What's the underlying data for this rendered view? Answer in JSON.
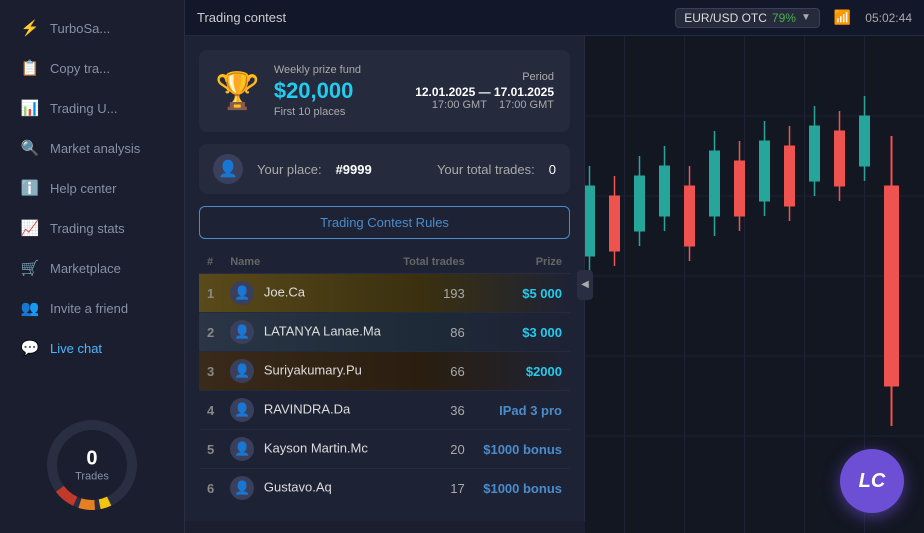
{
  "sidebar": {
    "items": [
      {
        "id": "turbosave",
        "label": "TurboSa...",
        "icon": "⚡",
        "active": false
      },
      {
        "id": "copy-trading",
        "label": "Copy tra...",
        "icon": "📋",
        "active": false
      },
      {
        "id": "trading-ui",
        "label": "Trading U...",
        "icon": "📊",
        "active": false
      },
      {
        "id": "market-analysis",
        "label": "Market analysis",
        "icon": "🔍",
        "active": false
      },
      {
        "id": "help-center",
        "label": "Help center",
        "icon": "ℹ️",
        "active": false
      },
      {
        "id": "trading-stats",
        "label": "Trading stats",
        "icon": "📈",
        "active": false
      },
      {
        "id": "marketplace",
        "label": "Marketplace",
        "icon": "🛒",
        "active": false
      },
      {
        "id": "invite-friend",
        "label": "Invite a friend",
        "icon": "👥",
        "active": false
      },
      {
        "id": "live-chat",
        "label": "Live chat",
        "icon": "💬",
        "active": true
      }
    ],
    "trades_count": "0",
    "trades_label": "Trades"
  },
  "topbar": {
    "title": "Trading contest",
    "currency": "EUR/USD OTC",
    "percentage": "79%",
    "time": "05:02:44"
  },
  "contest": {
    "prize_label": "Weekly prize fund",
    "prize_amount": "$20,000",
    "first_places": "First 10 places",
    "period_label": "Period",
    "period_dates": "12.01.2025 — 17.01.2025",
    "period_time_start": "17:00 GMT",
    "period_time_end": "17:00 GMT",
    "your_place_label": "Your place:",
    "your_place_value": "#9999",
    "your_trades_label": "Your total trades:",
    "your_trades_value": "0",
    "rules_button": "Trading Contest Rules"
  },
  "leaderboard": {
    "headers": {
      "num": "#",
      "name": "Name",
      "total_trades": "Total trades",
      "prize": "Prize"
    },
    "rows": [
      {
        "rank": 1,
        "name": "Joe.Ca",
        "trades": 193,
        "prize": "$5 000",
        "prize_type": "money"
      },
      {
        "rank": 2,
        "name": "LATANYA Lanae.Ma",
        "trades": 86,
        "prize": "$3 000",
        "prize_type": "money"
      },
      {
        "rank": 3,
        "name": "Suriyakumary.Pu",
        "trades": 66,
        "prize": "$2000",
        "prize_type": "money"
      },
      {
        "rank": 4,
        "name": "RAVINDRA.Da",
        "trades": 36,
        "prize": "IPad 3 pro",
        "prize_type": "ipad"
      },
      {
        "rank": 5,
        "name": "Kayson Martin.Mc",
        "trades": 20,
        "prize": "$1000 bonus",
        "prize_type": "bonus"
      },
      {
        "rank": 6,
        "name": "Gustavo.Aq",
        "trades": 17,
        "prize": "$1000 bonus",
        "prize_type": "bonus"
      }
    ]
  }
}
